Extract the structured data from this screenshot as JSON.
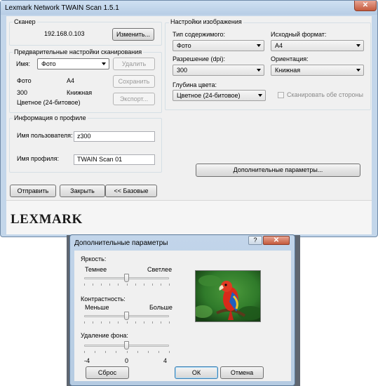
{
  "window": {
    "title": "Lexmark Network TWAIN Scan  1.5.1",
    "close_glyph": "✕"
  },
  "scanner": {
    "group_label": "Сканер",
    "address": "192.168.0.103",
    "change_button": "Изменить..."
  },
  "presets": {
    "group_label": "Предварительные настройки сканирования",
    "name_label": "Имя:",
    "name_value": "Фото",
    "delete_button": "Удалить",
    "save_button": "Сохранить",
    "export_button": "Экспорт...",
    "summary": {
      "content": "Фото",
      "format": "A4",
      "resolution": "300",
      "orientation": "Книжная",
      "color": "Цветное (24-битовое)"
    }
  },
  "profile": {
    "group_label": "Информация о профиле",
    "username_label": "Имя пользователя:",
    "username_value": "z300",
    "profile_label": "Имя профиля:",
    "profile_value": "TWAIN Scan 01"
  },
  "image_settings": {
    "group_label": "Настройки изображения",
    "content_type_label": "Тип содержимого:",
    "content_type_value": "Фото",
    "original_format_label": "Исходный формат:",
    "original_format_value": "A4",
    "resolution_label": "Разрешение (dpi):",
    "resolution_value": "300",
    "orientation_label": "Ориентация:",
    "orientation_value": "Книжная",
    "color_depth_label": "Глубина цвета:",
    "color_depth_value": "Цветное (24-битовое)",
    "duplex_label": "Сканировать обе стороны",
    "duplex_checked": false,
    "advanced_button": "Дополнительные параметры..."
  },
  "footer_buttons": {
    "send": "Отправить",
    "close": "Закрыть",
    "basic": "<< Базовые"
  },
  "logo": "LEXMARK",
  "advanced_dialog": {
    "title": "Дополнительные параметры",
    "help_glyph": "?",
    "close_glyph": "✕",
    "brightness": {
      "label": "Яркость:",
      "min_label": "Темнее",
      "max_label": "Светлее",
      "value_fraction": 0.5
    },
    "contrast": {
      "label": "Контрастность:",
      "min_label": "Меньше",
      "max_label": "Больше",
      "value_fraction": 0.5
    },
    "background_removal": {
      "label": "Удаление фона:",
      "scale": [
        "-4",
        "0",
        "4"
      ],
      "value": 0
    },
    "reset_button": "Сброс",
    "ok_button": "ОК",
    "cancel_button": "Отмена"
  },
  "colors": {
    "titlebar": "#c3d6ea",
    "client": "#f0f0f0",
    "close_button": "#c45a3d",
    "preview_green": "#2f7a2a",
    "parrot_red": "#d92a1a"
  }
}
